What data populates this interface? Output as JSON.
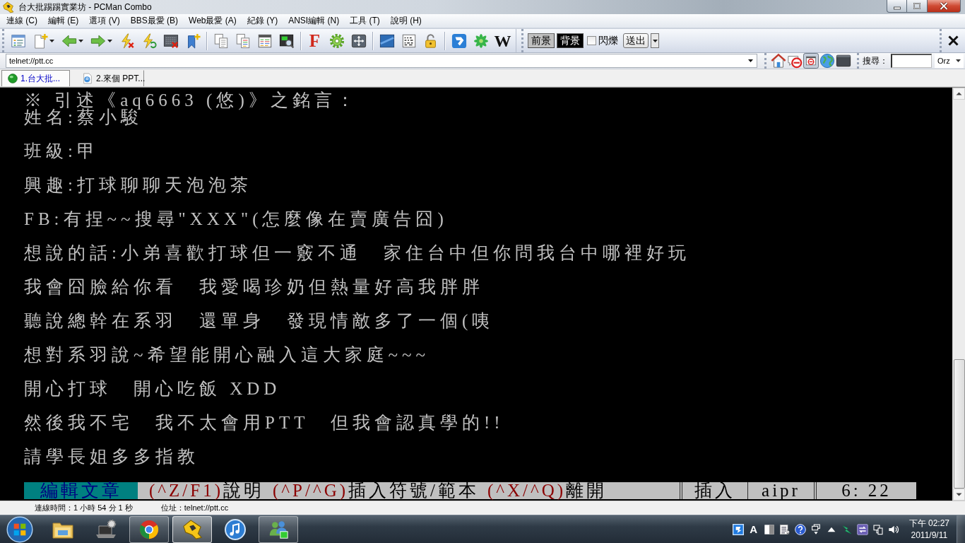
{
  "window": {
    "title": "台大批踢踢實業坊 - PCMan Combo"
  },
  "menu": [
    "連線 (C)",
    "編輯 (E)",
    "選項 (V)",
    "BBS最愛 (B)",
    "Web最愛 (A)",
    "紀錄 (Y)",
    "ANSI編輯 (N)",
    "工具 (T)",
    "說明 (H)"
  ],
  "toolbar": {
    "glyph_buttons": [
      "F",
      "W"
    ]
  },
  "color_toolbar": {
    "color_buttons": [
      {
        "label": "前景",
        "color": "#c0c0c0"
      },
      {
        "label": "背景",
        "color": "#000000"
      }
    ],
    "blink": {
      "label": "閃爍",
      "checked": false
    },
    "send_label": "送出"
  },
  "address_bar": {
    "value": "telnet://ptt.cc",
    "quick_buttons": [
      {
        "selected": false
      },
      {
        "selected": false
      },
      {
        "selected": true
      },
      {
        "selected": false
      },
      {
        "selected": false
      }
    ]
  },
  "search": {
    "label": "搜尋：",
    "engine": "Orz"
  },
  "tabs": [
    {
      "label": "1.台大批...",
      "kind": "bbs",
      "selected": true
    },
    {
      "label": "2.來個 PPT...",
      "kind": "web",
      "selected": false
    }
  ],
  "terminal": {
    "quote_header": "※ 引述《aq6663 (悠)》之銘言：",
    "lines": [
      "姓名:蔡小駿",
      "班級:甲",
      "興趣:打球聊聊天泡泡茶",
      "FB:有捏~~搜尋\"XXX\"(怎麼像在賣廣告囧)",
      "想說的話:小弟喜歡打球但一竅不通　家住台中但你問我台中哪裡好玩",
      "我會囧臉給你看　我愛喝珍奶但熱量好高我胖胖",
      "聽說總幹在系羽　還單身　發現情敵多了一個(咦",
      "想對系羽說~希望能開心融入這大家庭~~~",
      "開心打球　開心吃飯 XDD",
      "然後我不宅　我不太會用PTT　但我會認真學的!!",
      "請學長姐多多指教"
    ],
    "editor_status": {
      "mode": "編輯文章",
      "hints": [
        {
          "keys": "(^Z/F1)",
          "action": "說明"
        },
        {
          "keys": "(^P/^G)",
          "action": "插入符號/範本"
        },
        {
          "keys": "(^X/^Q)",
          "action": "離開"
        }
      ],
      "fields": [
        "插入",
        "aipr",
        "6: 22"
      ]
    }
  },
  "status_bar": {
    "connection_time": "連線時間：1 小時 54 分 1 秒",
    "address": "位址：telnet://ptt.cc"
  },
  "taskbar": {
    "apps": [
      {
        "running": false,
        "selected": false
      },
      {
        "running": false,
        "selected": false
      },
      {
        "running": true,
        "selected": false
      },
      {
        "running": true,
        "selected": true
      },
      {
        "running": false,
        "selected": false
      },
      {
        "running": true,
        "selected": false
      }
    ],
    "tray": {
      "input_mode": "A"
    },
    "clock": {
      "time": "下午 02:27",
      "date": "2011/9/11"
    }
  }
}
